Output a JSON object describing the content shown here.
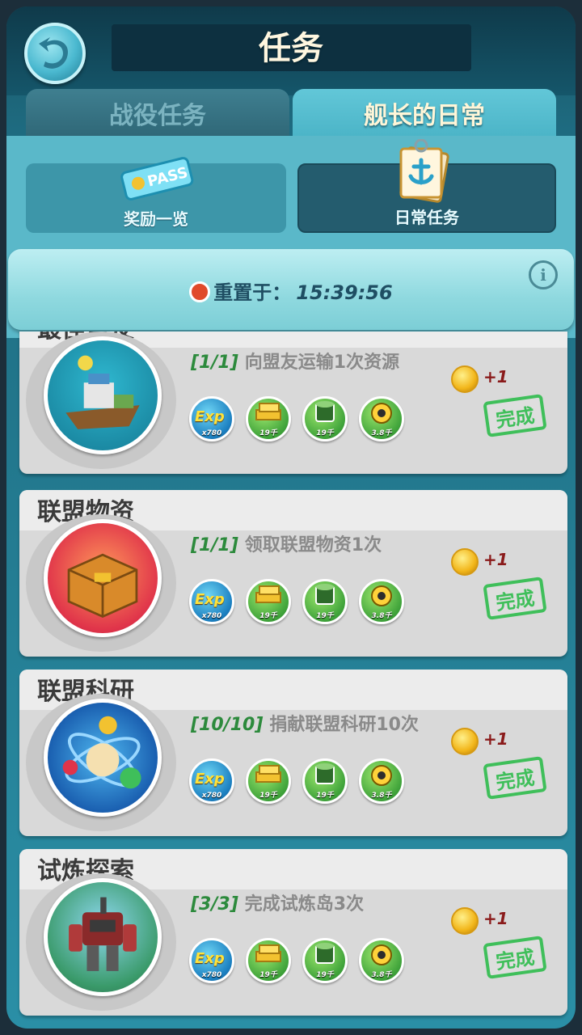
{
  "header": {
    "title": "任务"
  },
  "tabs": [
    {
      "label": "战役任务",
      "active": false
    },
    {
      "label": "舰长的日常",
      "active": true
    }
  ],
  "subtabs": [
    {
      "label": "奖励一览",
      "icon": "pass-ticket-icon",
      "badge": "PASS"
    },
    {
      "label": "日常任务",
      "icon": "daily-clipboard-icon"
    }
  ],
  "reset": {
    "label": "重置于：",
    "time": "15:39:56"
  },
  "rewards": {
    "exp_label": "Exp",
    "exp_amount": "x780",
    "gold": "19千",
    "stone": "19千",
    "iron": "3.8千"
  },
  "tasks": [
    {
      "title": "最佳盟友",
      "progress": "[1/1]",
      "desc": "向盟友运输1次资源",
      "token_reward": "+1",
      "status": "完成",
      "image": "cargo-boat"
    },
    {
      "title": "联盟物资",
      "progress": "[1/1]",
      "desc": "领取联盟物资1次",
      "token_reward": "+1",
      "status": "完成",
      "image": "supply-crate"
    },
    {
      "title": "联盟科研",
      "progress": "[10/10]",
      "desc": "捐献联盟科研10次",
      "token_reward": "+1",
      "status": "完成",
      "image": "atom-research"
    },
    {
      "title": "试炼探索",
      "progress": "[3/3]",
      "desc": "完成试炼岛3次",
      "token_reward": "+1",
      "status": "完成",
      "image": "mech-robot"
    }
  ],
  "colors": {
    "complete_stamp": "#3fbf5a",
    "progress_green": "#2c8a3c",
    "accent": "#5ab8c9"
  }
}
